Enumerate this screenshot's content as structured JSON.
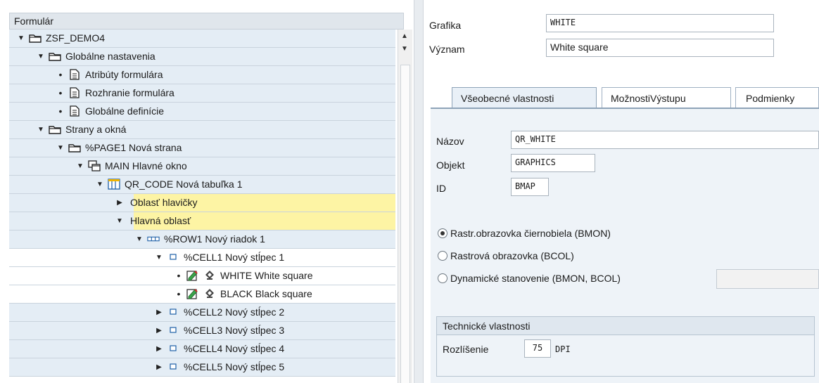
{
  "tree": {
    "header": "Formulár",
    "rows": [
      {
        "label": "ZSF_DEMO4",
        "icon": "folder-icon",
        "expander": "▼"
      },
      {
        "label": "Globálne nastavenia",
        "icon": "folder-icon",
        "expander": "▼"
      },
      {
        "label": "Atribúty formulára",
        "icon": "document-icon",
        "expander": "•"
      },
      {
        "label": "Rozhranie formulára",
        "icon": "document-icon",
        "expander": "•"
      },
      {
        "label": "Globálne definície",
        "icon": "document-icon",
        "expander": "•"
      },
      {
        "label": "Strany a okná",
        "icon": "folder-icon",
        "expander": "▼"
      },
      {
        "label": "%PAGE1 Nová strana",
        "icon": "folder-icon",
        "expander": "▼"
      },
      {
        "label": "MAIN Hlavné okno",
        "icon": "window-icon",
        "expander": "▼"
      },
      {
        "label": "QR_CODE Nová tabuľka 1",
        "icon": "table-icon",
        "expander": "▼"
      },
      {
        "label": "Oblasť hlavičky",
        "icon": "",
        "expander": "▶"
      },
      {
        "label": "Hlavná oblasť",
        "icon": "",
        "expander": "▼"
      },
      {
        "label": "%ROW1 Nový riadok 1",
        "icon": "row-icon",
        "expander": "▼"
      },
      {
        "label": "%CELL1 Nový stĺpec 1",
        "icon": "cell-icon",
        "expander": "▼"
      },
      {
        "label": "WHITE White square",
        "icon": "graphic-icon",
        "expander": "•"
      },
      {
        "label": "BLACK Black square",
        "icon": "graphic-icon",
        "expander": "•"
      },
      {
        "label": "%CELL2 Nový stĺpec 2",
        "icon": "cell-icon",
        "expander": "▶"
      },
      {
        "label": "%CELL3 Nový stĺpec 3",
        "icon": "cell-icon",
        "expander": "▶"
      },
      {
        "label": "%CELL4 Nový stĺpec 4",
        "icon": "cell-icon",
        "expander": "▶"
      },
      {
        "label": "%CELL5 Nový stĺpec 5",
        "icon": "cell-icon",
        "expander": "▶"
      }
    ]
  },
  "detail": {
    "grafika_label": "Grafika",
    "grafika_value": "WHITE",
    "vyznam_label": "Význam",
    "vyznam_value": "White square",
    "tabs": [
      "Všeobecné vlastnosti",
      "MožnostiVýstupu",
      "Podmienky"
    ],
    "nazov_label": "Názov",
    "nazov_value": "QR_WHITE",
    "objekt_label": "Objekt",
    "objekt_value": "GRAPHICS",
    "id_label": "ID",
    "id_value": "BMAP",
    "radio_options": [
      {
        "label": "Rastr.obrazovka čiernobiela (BMON)",
        "selected": true
      },
      {
        "label": "Rastrová obrazovka (BCOL)",
        "selected": false
      },
      {
        "label": "Dynamické stanovenie (BMON, BCOL)",
        "selected": false
      }
    ],
    "tech_title": "Technické vlastnosti",
    "rozlisenie_label": "Rozlíšenie",
    "rozlisenie_value": "75",
    "dpi_label": "DPI"
  },
  "colors": {
    "selection_highlight": "#fdf4a4",
    "tree_row_bg": "#e4edf5",
    "tab_area_bg": "#eef3f8"
  }
}
